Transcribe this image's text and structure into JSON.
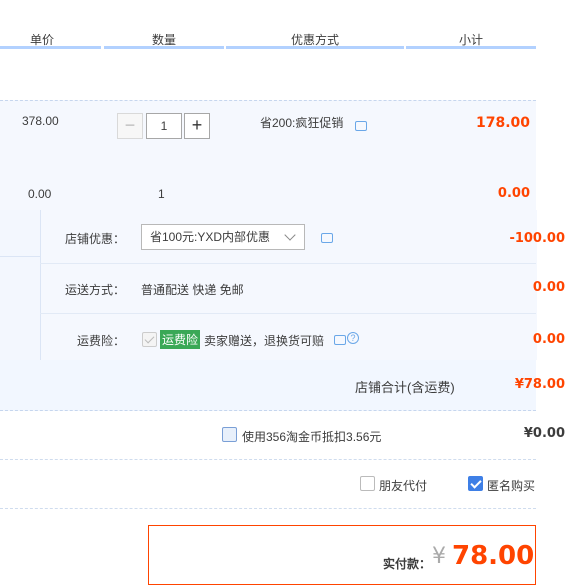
{
  "header": {
    "col_price": "单价",
    "col_qty": "数量",
    "col_discount": "优惠方式",
    "col_subtotal": "小计"
  },
  "item": {
    "price": "378.00",
    "quantity": "1",
    "promo": "省200:疯狂促销",
    "subtotal": "178.00",
    "minus": "−",
    "plus": "+"
  },
  "extra_row": {
    "price": "0.00",
    "quantity": "1",
    "subtotal": "0.00"
  },
  "shop": {
    "discount_label": "店铺优惠：",
    "discount_value": "省100元:YXD内部优惠",
    "discount_amount": "-100.00",
    "shipping_label": "运送方式：",
    "shipping_value": "普通配送 快递 免邮",
    "shipping_amount": "0.00",
    "insurance_label": "运费险：",
    "insurance_tag": "运费险",
    "insurance_text": "卖家赠送，退换货可赔",
    "insurance_amount": "0.00",
    "total_label": "店铺合计(含运费)",
    "total_value": "¥78.00"
  },
  "coins": {
    "label": "使用356淘金币抵扣3.56元",
    "value": "¥0.00",
    "checked": false
  },
  "options": {
    "friend_pay": "朋友代付",
    "friend_pay_checked": false,
    "anonymous": "匿名购买",
    "anonymous_checked": true
  },
  "payment": {
    "label": "实付款：",
    "currency": "¥",
    "amount": "78.00"
  },
  "colors": {
    "accent_red": "#ff4400",
    "header_line": "#b2d1ff",
    "checkbox_blue": "#3e7fe6",
    "tag_green": "#3aa856"
  }
}
